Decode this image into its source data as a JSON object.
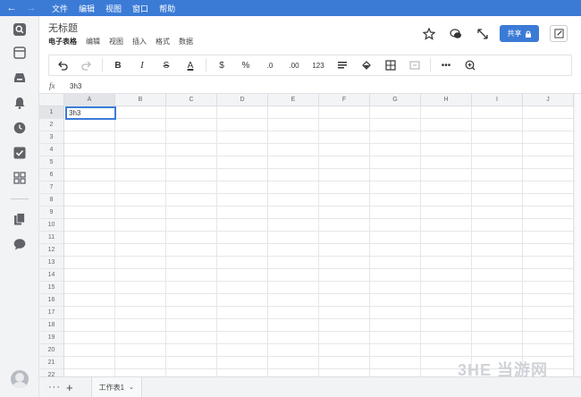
{
  "titlebar": {
    "menu": [
      "文件",
      "编辑",
      "视图",
      "窗口",
      "帮助"
    ]
  },
  "header": {
    "doc_title": "无标题",
    "doc_menu": [
      "电子表格",
      "编辑",
      "视图",
      "插入",
      "格式",
      "数据"
    ],
    "share_label": "共享"
  },
  "toolbar": {
    "currency": "$",
    "percent": "%",
    "dec_decrease": ".0",
    "dec_increase": ".00",
    "number_format": "123",
    "more": "•••"
  },
  "formula_bar": {
    "fx_label": "fx",
    "value": "3h3"
  },
  "grid": {
    "columns": [
      "A",
      "B",
      "C",
      "D",
      "E",
      "F",
      "G",
      "H",
      "I",
      "J"
    ],
    "rows": [
      "1",
      "2",
      "3",
      "4",
      "5",
      "6",
      "7",
      "8",
      "9",
      "10",
      "11",
      "12",
      "13",
      "14",
      "15",
      "16",
      "17",
      "18",
      "19",
      "20",
      "21",
      "22"
    ],
    "active_cell_value": "3h3"
  },
  "bottom": {
    "more": "···",
    "add": "+",
    "sheet_tab": "工作表1"
  },
  "watermark": "3HE 当游网",
  "colors": {
    "accent": "#3b7bd6",
    "rail_bg": "#f2f3f5"
  }
}
